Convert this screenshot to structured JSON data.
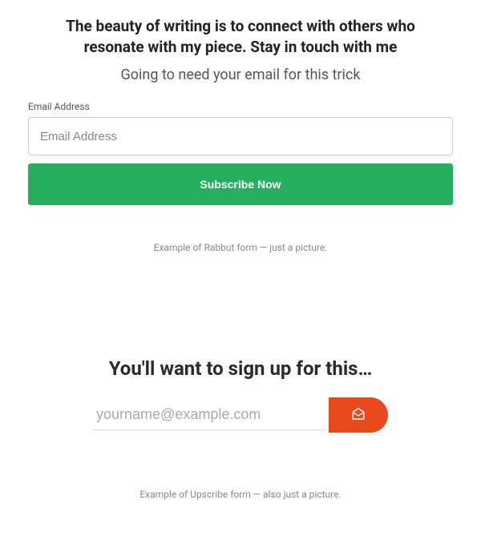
{
  "rabbut": {
    "headline": "The beauty of writing is to connect with others who resonate with my piece. Stay in touch with me",
    "subhead": "Going to need your email for this trick",
    "email_label": "Email Address",
    "email_placeholder": "Email Address",
    "button_label": "Subscribe Now",
    "caption": "Example of Rabbut form — just a picture."
  },
  "upscribe": {
    "headline": "You'll want to sign up for this…",
    "email_placeholder": "yourname@example.com",
    "caption": "Example of Upscribe form — also just a picture."
  }
}
